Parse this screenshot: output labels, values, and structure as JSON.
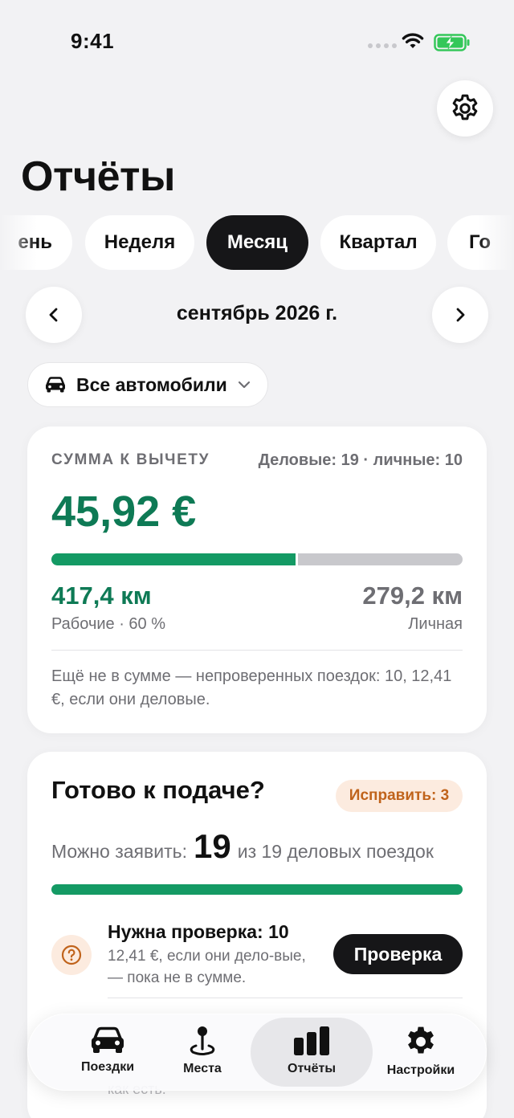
{
  "status_bar": {
    "time": "9:41"
  },
  "header": {
    "title": "Отчёты"
  },
  "periods": {
    "items": [
      "День",
      "Неделя",
      "Месяц",
      "Квартал",
      "Год"
    ],
    "visible": [
      "ень",
      "Неделя",
      "Месяц",
      "Квартал",
      "Го"
    ],
    "selected": "Месяц"
  },
  "period_nav": {
    "label": "сентябрь 2026 г."
  },
  "vehicle_filter": {
    "label": "Все автомобили"
  },
  "deduction_card": {
    "label": "СУММА К ВЫЧЕТУ",
    "trips_summary": "Деловые: 19 · личные: 10",
    "amount": "45,92 €",
    "work_share": 0.6,
    "work_km": "417,4 км",
    "work_label": "Рабочие · 60 %",
    "personal_km": "279,2 км",
    "personal_label": "Личная",
    "note": "Ещё не в сумме — непроверенных поездок: 10, 12,41 €, если они деловые."
  },
  "readiness_card": {
    "title": "Готово к подаче?",
    "fix_badge": "Исправить: 3",
    "claim_prefix": "Можно заявить:",
    "claim_count": "19",
    "claim_suffix": "из 19 деловых поездок",
    "claim_progress": 1.0,
    "check_title": "Нужна проверка: 10",
    "check_subtitle": "12,41 €, если они дело-вые, — пока не в сумме.",
    "check_button": "Проверка",
    "hidden_text": "как есть."
  },
  "tab_bar": {
    "items": [
      {
        "label": "Поездки",
        "icon": "car-icon"
      },
      {
        "label": "Места",
        "icon": "map-pin-icon"
      },
      {
        "label": "Отчёты",
        "icon": "bar-chart-icon"
      },
      {
        "label": "Настройки",
        "icon": "gear-icon"
      }
    ],
    "active": "Отчёты"
  },
  "colors": {
    "accent_green": "#0e7a55",
    "bar_green": "#149a64",
    "warning_orange": "#c0631b",
    "dark": "#161618"
  }
}
